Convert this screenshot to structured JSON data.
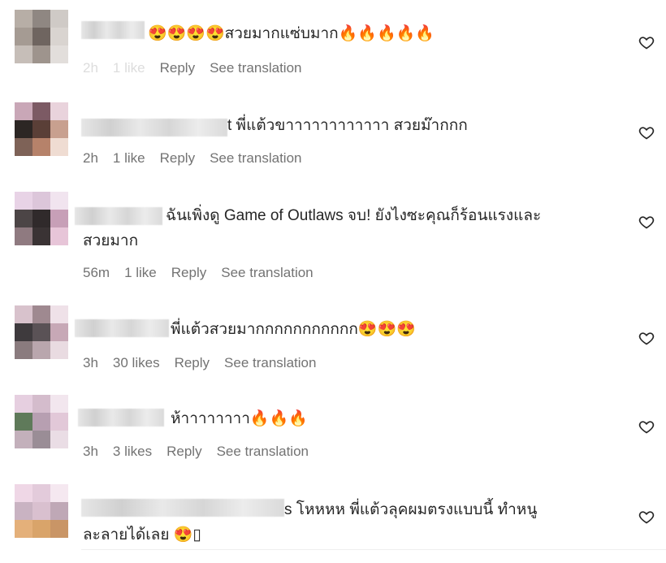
{
  "comments": [
    {
      "text": "😍😍😍😍สวยมากแซ่บมาก🔥🔥🔥🔥🔥",
      "time": "2h",
      "likes": "1 like",
      "reply": "Reply",
      "translate": "See translation",
      "avatar_colors": [
        "#b7aea6",
        "#8f8782",
        "#cfcac6",
        "#a59b93",
        "#6f6560",
        "#d9d4d0",
        "#c6beb8",
        "#9e948d",
        "#e2dedb"
      ]
    },
    {
      "text": "t พี่แต้วขาาาาาาาาาาาา สวยม๊ากกก",
      "time": "2h",
      "likes": "1 like",
      "reply": "Reply",
      "translate": "See translation",
      "avatar_colors": [
        "#c9a7b7",
        "#7c5a64",
        "#e9d3dc",
        "#2c2624",
        "#5a3f37",
        "#c8a08f",
        "#7e6257",
        "#b6826a",
        "#efdcd2"
      ]
    },
    {
      "text": "ฉันเพิ่งดู Game of Outlaws จบ! ยังไงซะคุณก็ร้อนแรงและ\nสวยมาก",
      "time": "56m",
      "likes": "1 like",
      "reply": "Reply",
      "translate": "See translation",
      "avatar_colors": [
        "#e8d3e6",
        "#dcc6da",
        "#f1e4ef",
        "#4c4546",
        "#302a2b",
        "#c79fb7",
        "#8f7a80",
        "#3a3334",
        "#e7c5d8"
      ]
    },
    {
      "text": "พี่แต้วสวยมากกกกกกกกกกก😍😍😍",
      "time": "3h",
      "likes": "30 likes",
      "reply": "Reply",
      "translate": "See translation",
      "avatar_colors": [
        "#d8c2cc",
        "#9f8990",
        "#efe1e8",
        "#3e3a3d",
        "#5a5256",
        "#c7a8b6",
        "#8a7b7e",
        "#b9a6ad",
        "#e9dbe1"
      ]
    },
    {
      "text": "ห้าาาาาาาา🔥🔥🔥",
      "time": "3h",
      "likes": "3 likes",
      "reply": "Reply",
      "translate": "See translation",
      "avatar_colors": [
        "#e6cfe0",
        "#d4bccc",
        "#f2e6ee",
        "#5f7a5a",
        "#b79fb1",
        "#e2c8d8",
        "#c3b0bb",
        "#9a8d96",
        "#eadde5"
      ]
    },
    {
      "text": "s โหหหห พี่แต้วลุคผมตรงแบบนี้ ทำหนู\nละลายได้เลย 😍▯",
      "time": "",
      "likes": "",
      "reply": "",
      "translate": "",
      "avatar_colors": [
        "#efd7e6",
        "#e3cbdb",
        "#f5e8f0",
        "#c9b3c2",
        "#d9c0cf",
        "#bfa8b6",
        "#e4b07a",
        "#d9a46a",
        "#c99566"
      ]
    }
  ],
  "icons": {
    "like": "heart-outline-icon"
  }
}
